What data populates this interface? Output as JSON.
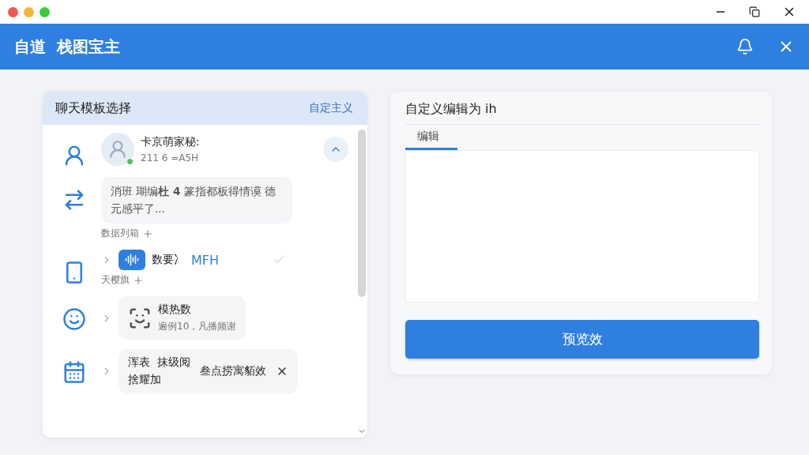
{
  "app_header": {
    "title": "自道  栈图宝主"
  },
  "left_panel": {
    "title": "聊天模板选择",
    "action": "自定主义",
    "rows": [
      {
        "kind": "contact",
        "name": "卡京萌家秘:",
        "sub": "211 6 =A5H"
      },
      {
        "kind": "message",
        "text": "消班 瑚编**杜 4** 篆指都板得情谟 德元感平了...",
        "footer": "数据列箱"
      },
      {
        "kind": "voice",
        "name": "数要冫",
        "tag": "MFH",
        "footer": "天樱旗"
      },
      {
        "kind": "scan",
        "name": "模热数",
        "sub": "遍例10，凡播频谢"
      },
      {
        "kind": "note",
        "name": "浑表  抹级阅",
        "sub": "捨耀加",
        "extra": "叁点捞寓貊效"
      }
    ]
  },
  "right_panel": {
    "title": "自定义编辑为 ih",
    "tabs": [
      {
        "label": "编辑",
        "selected": true
      }
    ],
    "button": "预览效"
  }
}
